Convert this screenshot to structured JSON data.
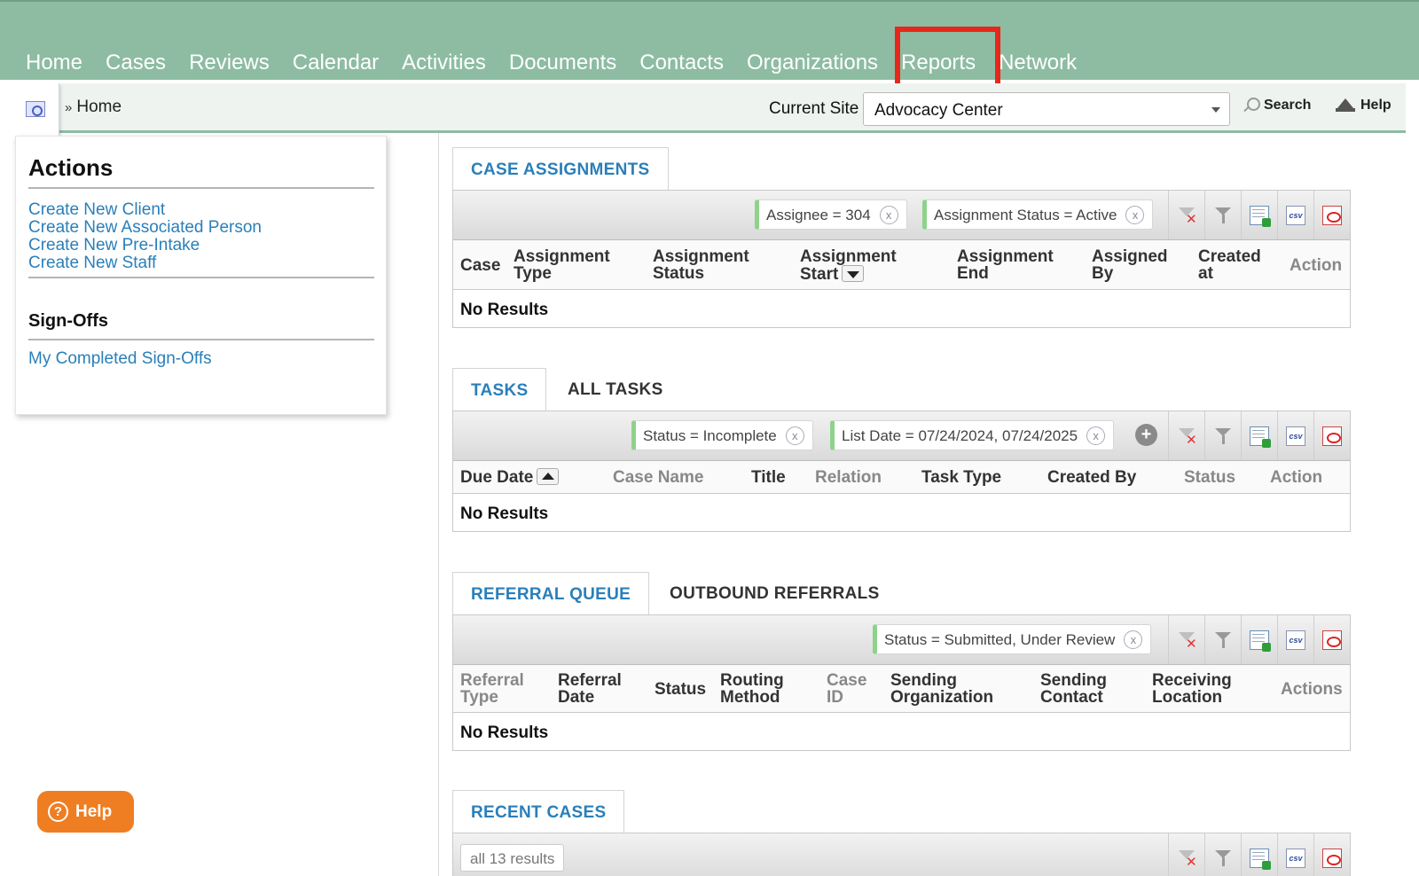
{
  "nav": {
    "items": [
      "Home",
      "Cases",
      "Reviews",
      "Calendar",
      "Activities",
      "Documents",
      "Contacts",
      "Organizations",
      "Reports",
      "Network"
    ]
  },
  "breadcrumb": {
    "separator": "»",
    "current": "Home"
  },
  "site": {
    "label": "Current Site",
    "value": "Advocacy Center"
  },
  "header_links": {
    "search": "Search",
    "help": "Help"
  },
  "actions_panel": {
    "title": "Actions",
    "links": [
      "Create New Client",
      "Create New Associated Person",
      "Create New Pre-Intake",
      "Create New Staff"
    ],
    "signoffs_title": "Sign-Offs",
    "signoffs_link": "My Completed Sign-Offs"
  },
  "case_assignments": {
    "tab": "CASE ASSIGNMENTS",
    "filters": [
      "Assignee = 304",
      "Assignment Status = Active"
    ],
    "columns": [
      "Case",
      "Assignment Type",
      "Assignment Status",
      "Assignment Start",
      "Assignment End",
      "Assigned By",
      "Created at",
      "Action"
    ],
    "empty": "No Results"
  },
  "tasks": {
    "tabs": [
      "TASKS",
      "ALL TASKS"
    ],
    "filters": [
      "Status = Incomplete",
      "List Date = 07/24/2024, 07/24/2025"
    ],
    "columns": [
      "Due Date",
      "Case Name",
      "Title",
      "Relation",
      "Task Type",
      "Created By",
      "Status",
      "Action"
    ],
    "empty": "No Results"
  },
  "referrals": {
    "tabs": [
      "REFERRAL QUEUE",
      "OUTBOUND REFERRALS"
    ],
    "filters": [
      "Status = Submitted, Under Review"
    ],
    "columns": [
      "Referral Type",
      "Referral Date",
      "Status",
      "Routing Method",
      "Case ID",
      "Sending Organization",
      "Sending Contact",
      "Receiving Location",
      "Actions"
    ],
    "empty": "No Results"
  },
  "recent_cases": {
    "tab": "RECENT CASES",
    "results": "all 13 results"
  },
  "tool_icons": [
    "clear-filter-icon",
    "filter-icon",
    "excel-export-icon",
    "csv-export-icon",
    "pdf-export-icon"
  ],
  "help_button": "Help",
  "chip_close": "x",
  "colors": {
    "nav_bg": "#8dbca2",
    "link": "#2a7fb9",
    "highlight": "#e8271b",
    "help_button": "#ef7d22"
  }
}
